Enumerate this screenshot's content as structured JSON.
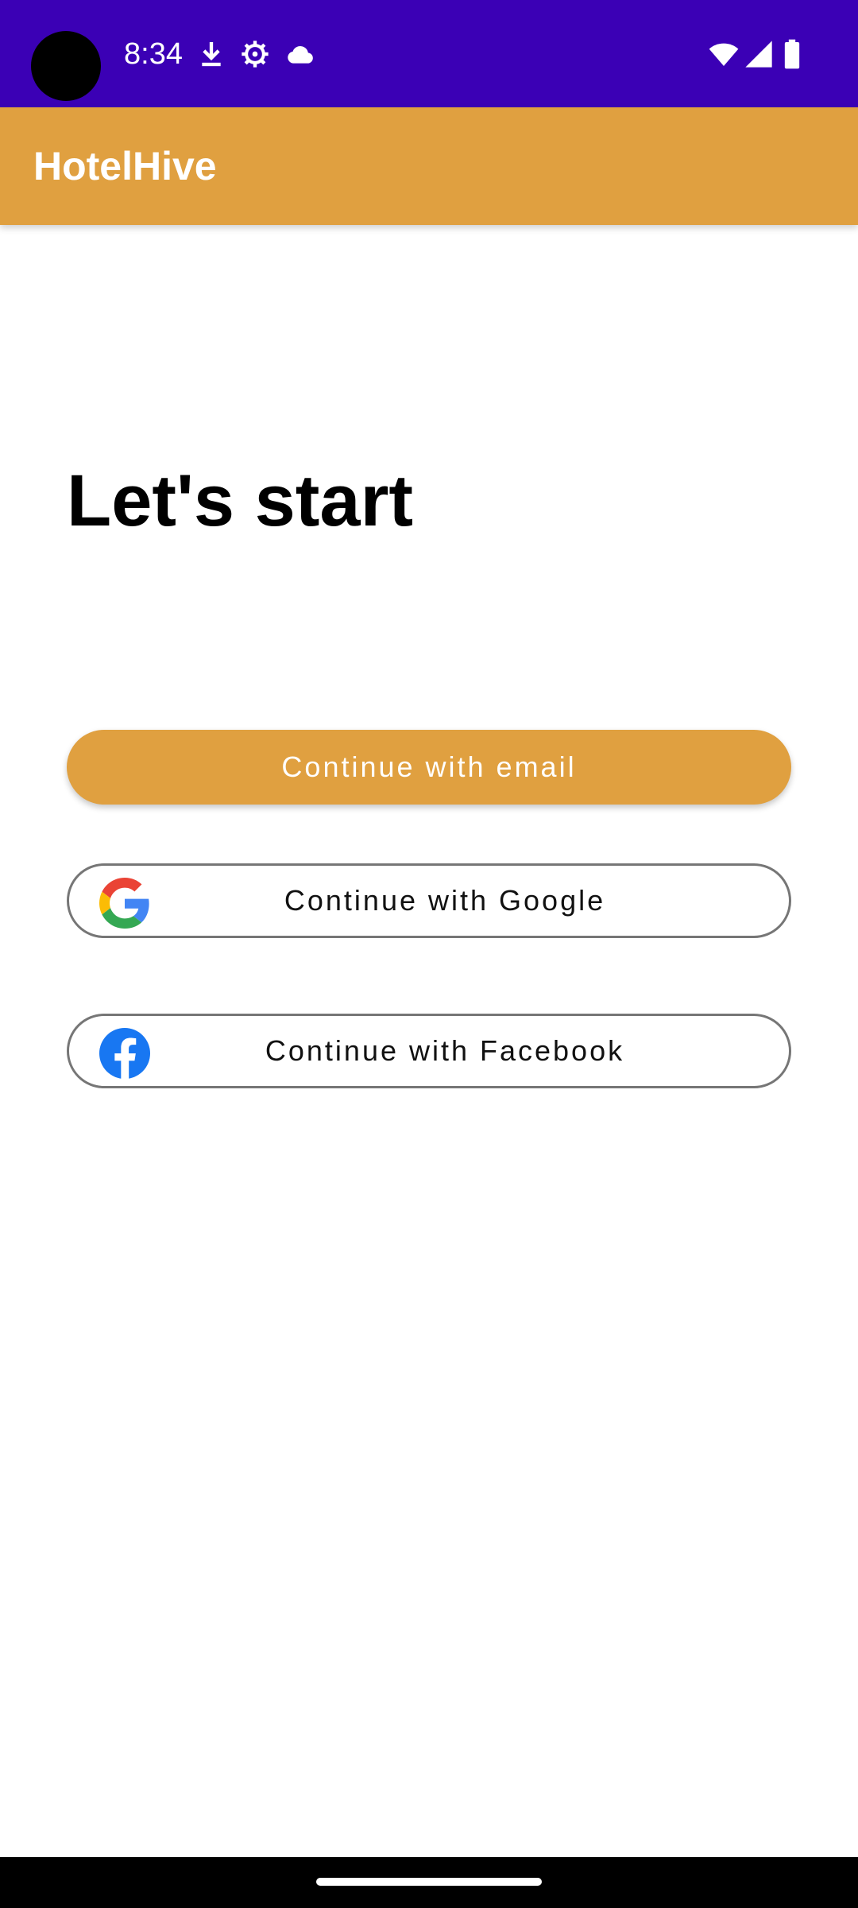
{
  "status_bar": {
    "time": "8:34",
    "icons": [
      "download-icon",
      "settings-icon",
      "cloud-icon",
      "wifi-icon",
      "signal-icon",
      "battery-icon"
    ]
  },
  "app_bar": {
    "title": "HotelHive"
  },
  "main": {
    "heading": "Let's start",
    "buttons": {
      "email_label": "Continue with email",
      "google_label": "Continue with Google",
      "facebook_label": "Continue with Facebook"
    }
  },
  "colors": {
    "status_bar": "#3b00b5",
    "accent": "#e0a040",
    "facebook_blue": "#1877f2"
  }
}
